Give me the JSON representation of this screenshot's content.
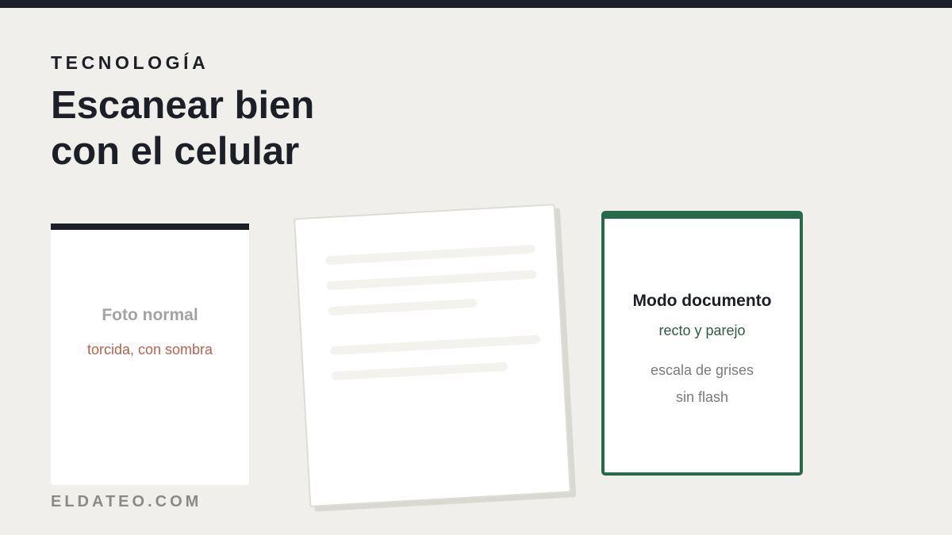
{
  "colors": {
    "background": "#f0efeb",
    "dark": "#1c1f26",
    "accent_green": "#256b4b",
    "warning_red": "#b8624c"
  },
  "header": {
    "kicker": "TECNOLOGÍA",
    "title_line1": "Escanear bien",
    "title_line2": "con el celular"
  },
  "normal_card": {
    "title": "Foto normal",
    "subtitle": "torcida, con sombra"
  },
  "document_card": {
    "title": "Modo documento",
    "subtitle": "recto y parejo",
    "notes": [
      "escala de grises",
      "sin flash"
    ]
  },
  "footer": {
    "site": "ELDATEO.COM"
  }
}
